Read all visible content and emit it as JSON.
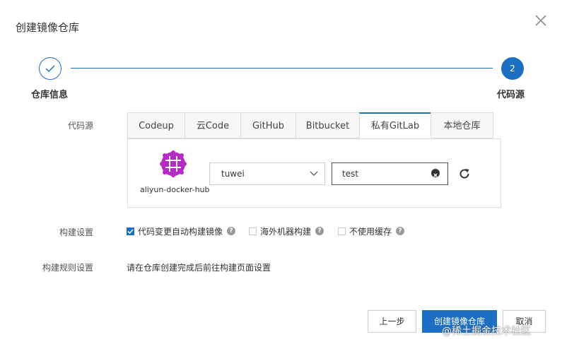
{
  "dialog": {
    "title": "创建镜像仓库",
    "close_icon": "close-icon"
  },
  "steps": [
    {
      "number": "1",
      "label": "仓库信息",
      "status": "done"
    },
    {
      "number": "2",
      "label": "代码源",
      "status": "active"
    }
  ],
  "source": {
    "label": "代码源",
    "tabs": [
      "Codeup",
      "云Code",
      "GitHub",
      "Bitbucket",
      "私有GitLab",
      "本地仓库"
    ],
    "active_tab": "私有GitLab",
    "account_name": "aliyun-docker-hub",
    "namespace_select": "tuwei",
    "repo_input": "test"
  },
  "build_settings": {
    "label": "构建设置",
    "options": [
      {
        "label": "代码变更自动构建镜像",
        "checked": true
      },
      {
        "label": "海外机器构建",
        "checked": false
      },
      {
        "label": "不使用缓存",
        "checked": false
      }
    ]
  },
  "build_rules": {
    "label": "构建规则设置",
    "text": "请在仓库创建完成后前往构建页面设置"
  },
  "footer": {
    "prev_label": "上一步",
    "create_label": "创建镜像仓库",
    "cancel_label": "取消"
  },
  "watermark": "@稀土掘金技术社区",
  "colors": {
    "accent": "#1d6fc4",
    "avatar": "#b62bc4"
  }
}
